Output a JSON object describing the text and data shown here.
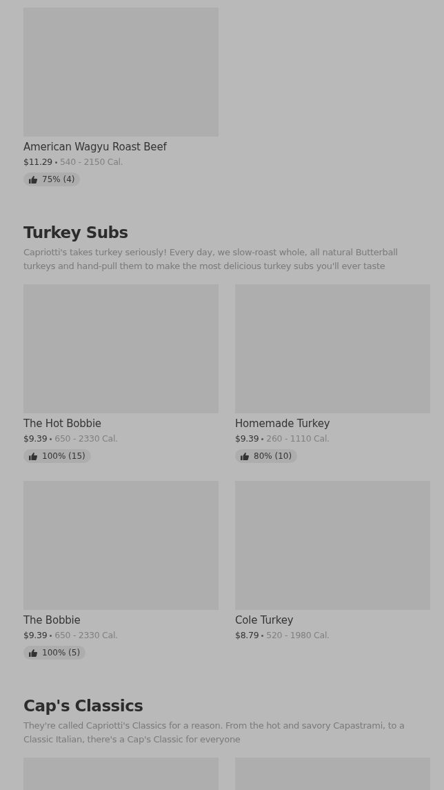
{
  "sections": [
    {
      "items": [
        {
          "kind": "full",
          "name": "American Wagyu Roast Beef",
          "price": "$11.29",
          "calories": "540 - 2150 Cal.",
          "rating": "75% (4)"
        }
      ]
    },
    {
      "title": "Turkey Subs",
      "description": "Capriotti's takes turkey seriously! Every day, we slow-roast whole, all natural Butterball turkeys and hand-pull them to make the most delicious turkey subs you'll ever taste",
      "items": [
        {
          "kind": "full",
          "name": "The Hot Bobbie",
          "price": "$9.39",
          "calories": "650 - 2330 Cal.",
          "rating": "100% (15)"
        },
        {
          "kind": "full",
          "name": "Homemade Turkey",
          "price": "$9.39",
          "calories": "260 - 1110 Cal.",
          "rating": "80% (10)"
        },
        {
          "kind": "full",
          "name": "The Bobbie",
          "price": "$9.39",
          "calories": "650 - 2330 Cal.",
          "rating": "100% (5)"
        },
        {
          "kind": "full",
          "name": "Cole Turkey",
          "price": "$8.79",
          "calories": "520 - 1980 Cal."
        }
      ]
    },
    {
      "title": "Cap's Classics",
      "description": "They're called Capriotti's Classics for a reason. From the hot and savory Capastrami, to a Classic Italian, there's a Cap's Classic for everyone",
      "items": [
        {
          "kind": "image_only"
        },
        {
          "kind": "image_only"
        }
      ]
    }
  ]
}
